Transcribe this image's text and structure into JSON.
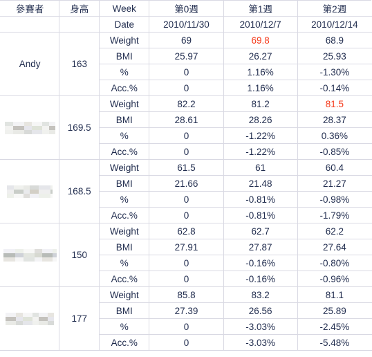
{
  "table": {
    "columns": {
      "name": "參賽者",
      "height": "身高",
      "metric_header": "Week",
      "metric_subheader": "Date"
    },
    "weeks": [
      {
        "label": "第0週",
        "date": "2010/11/30"
      },
      {
        "label": "第1週",
        "date": "2010/12/7"
      },
      {
        "label": "第2週",
        "date": "2010/12/14"
      }
    ],
    "metric_labels": {
      "weight": "Weight",
      "bmi": "BMI",
      "pct": "%",
      "acc": "Acc.%"
    },
    "participants": [
      {
        "name": "Andy",
        "name_redacted": false,
        "height": "163",
        "weight": [
          "69",
          "69.8",
          "68.9"
        ],
        "weight_red": [
          false,
          true,
          false
        ],
        "bmi": [
          "25.97",
          "26.27",
          "25.93"
        ],
        "pct": [
          "0",
          "1.16%",
          "-1.30%"
        ],
        "pct_highlight": [
          "none",
          "none",
          "none"
        ],
        "acc": [
          "0",
          "1.16%",
          "-0.14%"
        ],
        "acc_highlight": [
          "none",
          "none",
          "none"
        ]
      },
      {
        "name": "",
        "name_redacted": true,
        "height": "169.5",
        "weight": [
          "82.2",
          "81.2",
          "81.5"
        ],
        "weight_red": [
          false,
          false,
          true
        ],
        "bmi": [
          "28.61",
          "28.26",
          "28.37"
        ],
        "pct": [
          "0",
          "-1.22%",
          "0.36%"
        ],
        "pct_highlight": [
          "none",
          "none",
          "none"
        ],
        "acc": [
          "0",
          "-1.22%",
          "-0.85%"
        ],
        "acc_highlight": [
          "none",
          "none",
          "none"
        ]
      },
      {
        "name": "",
        "name_redacted": true,
        "height": "168.5",
        "weight": [
          "61.5",
          "61",
          "60.4"
        ],
        "weight_red": [
          false,
          false,
          false
        ],
        "bmi": [
          "21.66",
          "21.48",
          "21.27"
        ],
        "pct": [
          "0",
          "-0.81%",
          "-0.98%"
        ],
        "pct_highlight": [
          "none",
          "none",
          "none"
        ],
        "acc": [
          "0",
          "-0.81%",
          "-1.79%"
        ],
        "acc_highlight": [
          "none",
          "none",
          "none"
        ]
      },
      {
        "name": "",
        "name_redacted": true,
        "height": "150",
        "weight": [
          "62.8",
          "62.7",
          "62.2"
        ],
        "weight_red": [
          false,
          false,
          false
        ],
        "bmi": [
          "27.91",
          "27.87",
          "27.64"
        ],
        "pct": [
          "0",
          "-0.16%",
          "-0.80%"
        ],
        "pct_highlight": [
          "none",
          "none",
          "none"
        ],
        "acc": [
          "0",
          "-0.16%",
          "-0.96%"
        ],
        "acc_highlight": [
          "none",
          "none",
          "none"
        ]
      },
      {
        "name": "",
        "name_redacted": true,
        "height": "177",
        "weight": [
          "85.8",
          "83.2",
          "81.1"
        ],
        "weight_red": [
          false,
          false,
          false
        ],
        "bmi": [
          "27.39",
          "26.56",
          "25.89"
        ],
        "pct": [
          "0",
          "-3.03%",
          "-2.45%"
        ],
        "pct_highlight": [
          "none",
          "orange",
          "orange"
        ],
        "acc": [
          "0",
          "-3.03%",
          "-5.48%"
        ],
        "acc_highlight": [
          "none",
          "none",
          "green"
        ]
      }
    ]
  },
  "colors": {
    "red_text": "#f5391a",
    "highlight_orange": "#fae0c8",
    "highlight_green": "#dfe9cd",
    "grid_line": "#d9d9e3",
    "text": "#1f2b4d"
  }
}
